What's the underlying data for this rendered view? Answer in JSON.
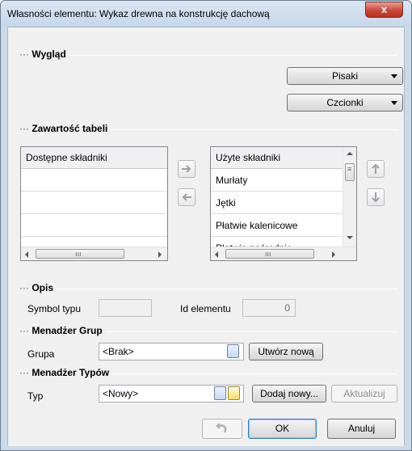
{
  "window": {
    "title": "Własności elementu: Wykaz drewna na konstrukcję dachową",
    "close_label": "x"
  },
  "appearance": {
    "section_title": "Wygląd",
    "pens_button": "Pisaki",
    "fonts_button": "Czcionki"
  },
  "table_content": {
    "section_title": "Zawartość tabeli",
    "available_header": "Dostępne składniki",
    "available_items": [],
    "used_header": "Użyte składniki",
    "used_items": [
      "Murłaty",
      "Jętki",
      "Płatwie kalenicowe",
      "Płatwie pośrednie"
    ]
  },
  "description": {
    "section_title": "Opis",
    "type_symbol_label": "Symbol typu",
    "type_symbol_value": "",
    "element_id_label": "Id elementu",
    "element_id_value": "0"
  },
  "group_manager": {
    "section_title": "Menadżer Grup",
    "group_label": "Grupa",
    "group_value": "<Brak>",
    "create_new_button": "Utwórz nową"
  },
  "type_manager": {
    "section_title": "Menadżer Typów",
    "type_label": "Typ",
    "type_value": "<Nowy>",
    "add_new_button": "Dodaj nowy...",
    "update_button": "Aktualizuj"
  },
  "footer": {
    "ok_button": "OK",
    "cancel_button": "Anuluj"
  }
}
